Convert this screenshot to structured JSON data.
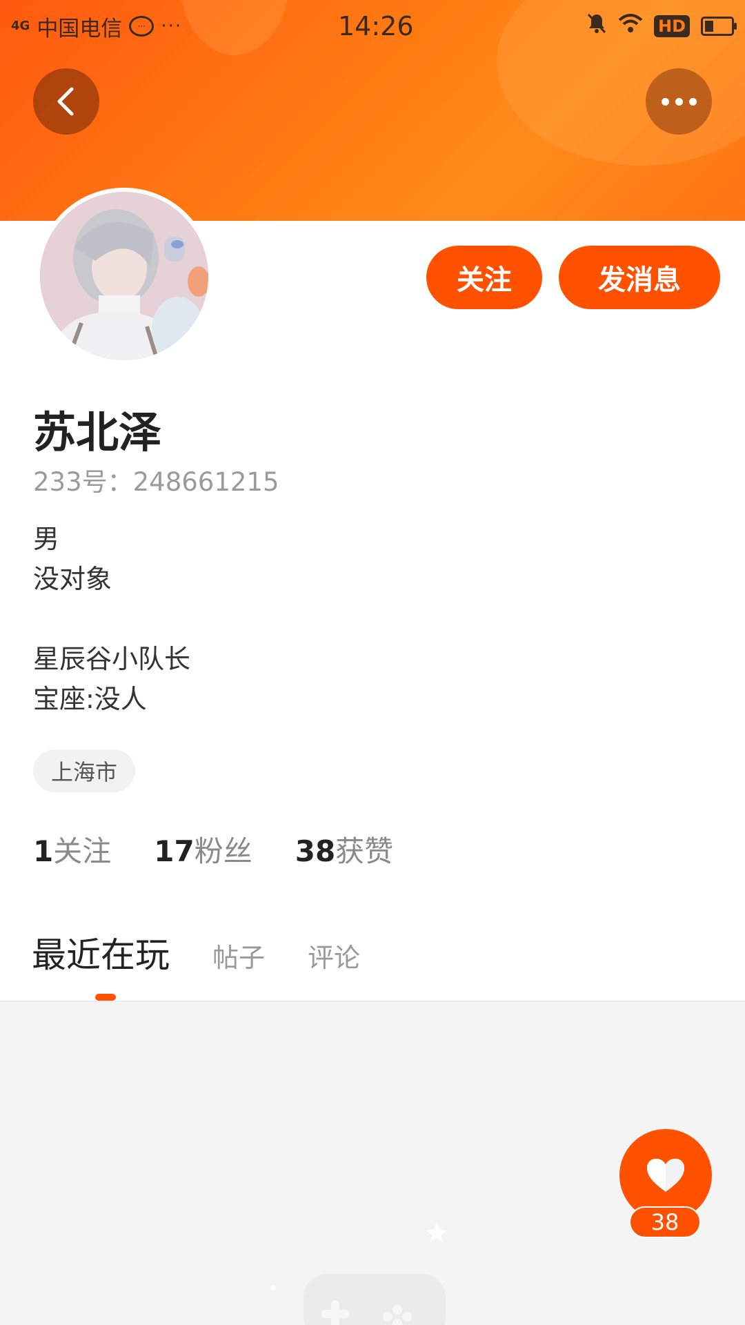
{
  "status_bar": {
    "signal": "4G",
    "carrier": "中国电信",
    "time": "14:26",
    "hd_label": "HD"
  },
  "header": {
    "back_icon": "chevron-left-icon",
    "more_icon": "more-horizontal-icon",
    "colors": {
      "gradient_start": "#ff5a10",
      "gradient_end": "#ff8a1a"
    }
  },
  "profile": {
    "name": "苏北泽",
    "uid": "233号：248661215",
    "bio_lines": [
      "男",
      "没对象",
      "",
      "星辰谷小队长",
      "宝座:没人"
    ],
    "location": "上海市"
  },
  "actions": {
    "follow_label": "关注",
    "message_label": "发消息"
  },
  "stats": {
    "following_count": "1",
    "following_label": "关注",
    "fans_count": "17",
    "fans_label": "粉丝",
    "likes_count": "38",
    "likes_label": "获赞"
  },
  "tabs": [
    {
      "label": "最近在玩",
      "active": true
    },
    {
      "label": "帖子",
      "active": false
    },
    {
      "label": "评论",
      "active": false
    }
  ],
  "like_button": {
    "icon": "heart-icon",
    "count": "38"
  },
  "accent_color": "#ff5100"
}
